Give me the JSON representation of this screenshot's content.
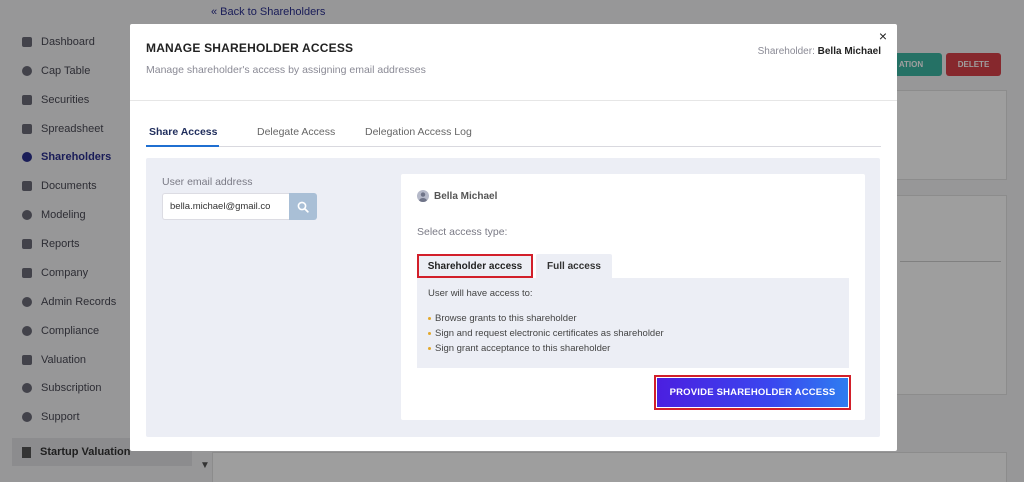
{
  "background": {
    "back_link": "« Back to Shareholders",
    "sidebar": {
      "items": [
        {
          "label": "Dashboard",
          "icon": "dashboard-icon"
        },
        {
          "label": "Cap Table",
          "icon": "pie-chart-icon"
        },
        {
          "label": "Securities",
          "icon": "clipboard-icon"
        },
        {
          "label": "Spreadsheet",
          "icon": "grid-icon"
        },
        {
          "label": "Shareholders",
          "icon": "user-icon"
        },
        {
          "label": "Documents",
          "icon": "folder-icon"
        },
        {
          "label": "Modeling",
          "icon": "bulb-icon"
        },
        {
          "label": "Reports",
          "icon": "report-icon"
        },
        {
          "label": "Company",
          "icon": "building-icon"
        },
        {
          "label": "Admin Records",
          "icon": "gear-icon"
        },
        {
          "label": "Compliance",
          "icon": "shield-icon"
        },
        {
          "label": "Valuation",
          "icon": "chart-icon"
        },
        {
          "label": "Subscription",
          "icon": "dollar-icon"
        },
        {
          "label": "Support",
          "icon": "support-icon"
        }
      ],
      "startup": "Startup Valuation"
    },
    "buttons": {
      "teal": "ATION",
      "delete": "DELETE"
    }
  },
  "modal": {
    "title": "MANAGE SHAREHOLDER ACCESS",
    "subtitle": "Manage shareholder's access by assigning email addresses",
    "shareholder_label": "Shareholder:",
    "shareholder_name": "Bella Michael",
    "close": "×",
    "tabs": [
      {
        "label": "Share Access",
        "active": true
      },
      {
        "label": "Delegate Access",
        "active": false
      },
      {
        "label": "Delegation Access Log",
        "active": false
      }
    ],
    "email": {
      "label": "User email address",
      "value": "bella.michael@gmail.co",
      "placeholder": "Email"
    },
    "card": {
      "user_name": "Bella Michael",
      "select_type_label": "Select access type:",
      "types": [
        {
          "label": "Shareholder access",
          "selected": true
        },
        {
          "label": "Full access",
          "selected": false
        }
      ],
      "intro": "User will have access to:",
      "bullets": [
        "Browse grants to this shareholder",
        "Sign and request electronic certificates as shareholder",
        "Sign grant acceptance to this shareholder"
      ],
      "submit_label": "PROVIDE SHAREHOLDER ACCESS"
    }
  },
  "colors": {
    "accent": "#2a2f8f",
    "highlight_border": "#d21f2a",
    "button_gradient_start": "#4b1fe0",
    "button_gradient_end": "#2e7df0",
    "bullet": "#e3a82b"
  }
}
